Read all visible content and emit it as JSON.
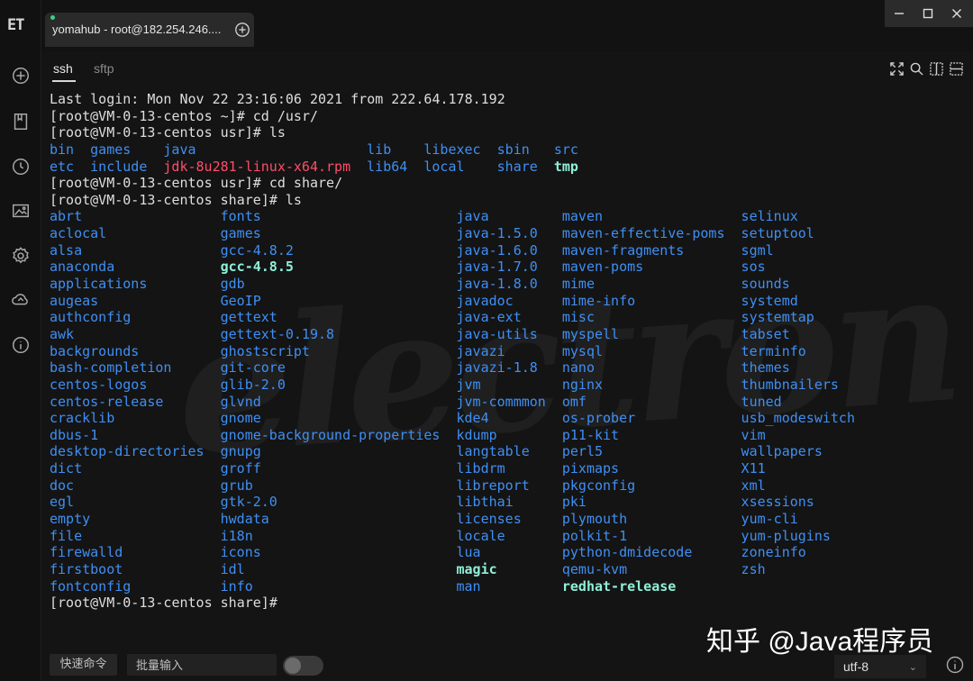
{
  "app": {
    "logo_text": "ET",
    "tab_title": "yomahub - root@182.254.246....",
    "subtabs": [
      "ssh",
      "sftp"
    ]
  },
  "colors": {
    "dir": "#3f8ff4",
    "exe": "#8ff0d8",
    "archive": "#ff4d6a",
    "plain": "#dedede",
    "session_dot": "#3ad18a"
  },
  "icons": {
    "rail": [
      "add-session-icon",
      "bookmark-icon",
      "history-icon",
      "image-icon",
      "settings-icon",
      "cloud-sync-icon",
      "info-icon"
    ],
    "toolbar": [
      "fullscreen-icon",
      "search-icon",
      "split-vertical-icon",
      "split-horizontal-icon"
    ]
  },
  "terminal": {
    "lines": [
      [
        {
          "t": "Last login: Mon Nov 22 23:16:06 2021 from 222.64.178.192",
          "c": "plain",
          "col": 0
        }
      ],
      [
        {
          "t": "[root@VM-0-13-centos ~]# cd /usr/",
          "c": "plain",
          "col": 0
        }
      ],
      [
        {
          "t": "[root@VM-0-13-centos usr]# ls",
          "c": "plain",
          "col": 0
        }
      ],
      [
        {
          "t": "bin",
          "c": "dir",
          "col": 0
        },
        {
          "t": "games",
          "c": "dir",
          "col": 5
        },
        {
          "t": "java",
          "c": "dir",
          "col": 14
        },
        {
          "t": "lib",
          "c": "dir",
          "col": 39
        },
        {
          "t": "libexec",
          "c": "dir",
          "col": 46
        },
        {
          "t": "sbin",
          "c": "dir",
          "col": 55
        },
        {
          "t": "src",
          "c": "dir",
          "col": 62
        }
      ],
      [
        {
          "t": "etc",
          "c": "dir",
          "col": 0
        },
        {
          "t": "include",
          "c": "dir",
          "col": 5
        },
        {
          "t": "jdk-8u281-linux-x64.rpm",
          "c": "archive",
          "col": 14
        },
        {
          "t": "lib64",
          "c": "dir",
          "col": 39
        },
        {
          "t": "local",
          "c": "dir",
          "col": 46
        },
        {
          "t": "share",
          "c": "dir",
          "col": 55
        },
        {
          "t": "tmp",
          "c": "exe",
          "col": 62
        }
      ],
      [
        {
          "t": "[root@VM-0-13-centos usr]# cd share/",
          "c": "plain",
          "col": 0
        }
      ],
      [
        {
          "t": "[root@VM-0-13-centos share]# ls",
          "c": "plain",
          "col": 0
        }
      ],
      [
        {
          "t": "abrt",
          "c": "dir",
          "col": 0
        },
        {
          "t": "fonts",
          "c": "dir",
          "col": 21
        },
        {
          "t": "java",
          "c": "dir",
          "col": 50
        },
        {
          "t": "maven",
          "c": "dir",
          "col": 63
        },
        {
          "t": "selinux",
          "c": "dir",
          "col": 85
        }
      ],
      [
        {
          "t": "aclocal",
          "c": "dir",
          "col": 0
        },
        {
          "t": "games",
          "c": "dir",
          "col": 21
        },
        {
          "t": "java-1.5.0",
          "c": "dir",
          "col": 50
        },
        {
          "t": "maven-effective-poms",
          "c": "dir",
          "col": 63
        },
        {
          "t": "setuptool",
          "c": "dir",
          "col": 85
        }
      ],
      [
        {
          "t": "alsa",
          "c": "dir",
          "col": 0
        },
        {
          "t": "gcc-4.8.2",
          "c": "dir",
          "col": 21
        },
        {
          "t": "java-1.6.0",
          "c": "dir",
          "col": 50
        },
        {
          "t": "maven-fragments",
          "c": "dir",
          "col": 63
        },
        {
          "t": "sgml",
          "c": "dir",
          "col": 85
        }
      ],
      [
        {
          "t": "anaconda",
          "c": "dir",
          "col": 0
        },
        {
          "t": "gcc-4.8.5",
          "c": "exe",
          "col": 21
        },
        {
          "t": "java-1.7.0",
          "c": "dir",
          "col": 50
        },
        {
          "t": "maven-poms",
          "c": "dir",
          "col": 63
        },
        {
          "t": "sos",
          "c": "dir",
          "col": 85
        }
      ],
      [
        {
          "t": "applications",
          "c": "dir",
          "col": 0
        },
        {
          "t": "gdb",
          "c": "dir",
          "col": 21
        },
        {
          "t": "java-1.8.0",
          "c": "dir",
          "col": 50
        },
        {
          "t": "mime",
          "c": "dir",
          "col": 63
        },
        {
          "t": "sounds",
          "c": "dir",
          "col": 85
        }
      ],
      [
        {
          "t": "augeas",
          "c": "dir",
          "col": 0
        },
        {
          "t": "GeoIP",
          "c": "dir",
          "col": 21
        },
        {
          "t": "javadoc",
          "c": "dir",
          "col": 50
        },
        {
          "t": "mime-info",
          "c": "dir",
          "col": 63
        },
        {
          "t": "systemd",
          "c": "dir",
          "col": 85
        }
      ],
      [
        {
          "t": "authconfig",
          "c": "dir",
          "col": 0
        },
        {
          "t": "gettext",
          "c": "dir",
          "col": 21
        },
        {
          "t": "java-ext",
          "c": "dir",
          "col": 50
        },
        {
          "t": "misc",
          "c": "dir",
          "col": 63
        },
        {
          "t": "systemtap",
          "c": "dir",
          "col": 85
        }
      ],
      [
        {
          "t": "awk",
          "c": "dir",
          "col": 0
        },
        {
          "t": "gettext-0.19.8",
          "c": "dir",
          "col": 21
        },
        {
          "t": "java-utils",
          "c": "dir",
          "col": 50
        },
        {
          "t": "myspell",
          "c": "dir",
          "col": 63
        },
        {
          "t": "tabset",
          "c": "dir",
          "col": 85
        }
      ],
      [
        {
          "t": "backgrounds",
          "c": "dir",
          "col": 0
        },
        {
          "t": "ghostscript",
          "c": "dir",
          "col": 21
        },
        {
          "t": "javazi",
          "c": "dir",
          "col": 50
        },
        {
          "t": "mysql",
          "c": "dir",
          "col": 63
        },
        {
          "t": "terminfo",
          "c": "dir",
          "col": 85
        }
      ],
      [
        {
          "t": "bash-completion",
          "c": "dir",
          "col": 0
        },
        {
          "t": "git-core",
          "c": "dir",
          "col": 21
        },
        {
          "t": "javazi-1.8",
          "c": "dir",
          "col": 50
        },
        {
          "t": "nano",
          "c": "dir",
          "col": 63
        },
        {
          "t": "themes",
          "c": "dir",
          "col": 85
        }
      ],
      [
        {
          "t": "centos-logos",
          "c": "dir",
          "col": 0
        },
        {
          "t": "glib-2.0",
          "c": "dir",
          "col": 21
        },
        {
          "t": "jvm",
          "c": "dir",
          "col": 50
        },
        {
          "t": "nginx",
          "c": "dir",
          "col": 63
        },
        {
          "t": "thumbnailers",
          "c": "dir",
          "col": 85
        }
      ],
      [
        {
          "t": "centos-release",
          "c": "dir",
          "col": 0
        },
        {
          "t": "glvnd",
          "c": "dir",
          "col": 21
        },
        {
          "t": "jvm-commmon",
          "c": "dir",
          "col": 50
        },
        {
          "t": "omf",
          "c": "dir",
          "col": 63
        },
        {
          "t": "tuned",
          "c": "dir",
          "col": 85
        }
      ],
      [
        {
          "t": "cracklib",
          "c": "dir",
          "col": 0
        },
        {
          "t": "gnome",
          "c": "dir",
          "col": 21
        },
        {
          "t": "kde4",
          "c": "dir",
          "col": 50
        },
        {
          "t": "os-prober",
          "c": "dir",
          "col": 63
        },
        {
          "t": "usb_modeswitch",
          "c": "dir",
          "col": 85
        }
      ],
      [
        {
          "t": "dbus-1",
          "c": "dir",
          "col": 0
        },
        {
          "t": "gnome-background-properties",
          "c": "dir",
          "col": 21
        },
        {
          "t": "kdump",
          "c": "dir",
          "col": 50
        },
        {
          "t": "p11-kit",
          "c": "dir",
          "col": 63
        },
        {
          "t": "vim",
          "c": "dir",
          "col": 85
        }
      ],
      [
        {
          "t": "desktop-directories",
          "c": "dir",
          "col": 0
        },
        {
          "t": "gnupg",
          "c": "dir",
          "col": 21
        },
        {
          "t": "langtable",
          "c": "dir",
          "col": 50
        },
        {
          "t": "perl5",
          "c": "dir",
          "col": 63
        },
        {
          "t": "wallpapers",
          "c": "dir",
          "col": 85
        }
      ],
      [
        {
          "t": "dict",
          "c": "dir",
          "col": 0
        },
        {
          "t": "groff",
          "c": "dir",
          "col": 21
        },
        {
          "t": "libdrm",
          "c": "dir",
          "col": 50
        },
        {
          "t": "pixmaps",
          "c": "dir",
          "col": 63
        },
        {
          "t": "X11",
          "c": "dir",
          "col": 85
        }
      ],
      [
        {
          "t": "doc",
          "c": "dir",
          "col": 0
        },
        {
          "t": "grub",
          "c": "dir",
          "col": 21
        },
        {
          "t": "libreport",
          "c": "dir",
          "col": 50
        },
        {
          "t": "pkgconfig",
          "c": "dir",
          "col": 63
        },
        {
          "t": "xml",
          "c": "dir",
          "col": 85
        }
      ],
      [
        {
          "t": "egl",
          "c": "dir",
          "col": 0
        },
        {
          "t": "gtk-2.0",
          "c": "dir",
          "col": 21
        },
        {
          "t": "libthai",
          "c": "dir",
          "col": 50
        },
        {
          "t": "pki",
          "c": "dir",
          "col": 63
        },
        {
          "t": "xsessions",
          "c": "dir",
          "col": 85
        }
      ],
      [
        {
          "t": "empty",
          "c": "dir",
          "col": 0
        },
        {
          "t": "hwdata",
          "c": "dir",
          "col": 21
        },
        {
          "t": "licenses",
          "c": "dir",
          "col": 50
        },
        {
          "t": "plymouth",
          "c": "dir",
          "col": 63
        },
        {
          "t": "yum-cli",
          "c": "dir",
          "col": 85
        }
      ],
      [
        {
          "t": "file",
          "c": "dir",
          "col": 0
        },
        {
          "t": "i18n",
          "c": "dir",
          "col": 21
        },
        {
          "t": "locale",
          "c": "dir",
          "col": 50
        },
        {
          "t": "polkit-1",
          "c": "dir",
          "col": 63
        },
        {
          "t": "yum-plugins",
          "c": "dir",
          "col": 85
        }
      ],
      [
        {
          "t": "firewalld",
          "c": "dir",
          "col": 0
        },
        {
          "t": "icons",
          "c": "dir",
          "col": 21
        },
        {
          "t": "lua",
          "c": "dir",
          "col": 50
        },
        {
          "t": "python-dmidecode",
          "c": "dir",
          "col": 63
        },
        {
          "t": "zoneinfo",
          "c": "dir",
          "col": 85
        }
      ],
      [
        {
          "t": "firstboot",
          "c": "dir",
          "col": 0
        },
        {
          "t": "idl",
          "c": "dir",
          "col": 21
        },
        {
          "t": "magic",
          "c": "exe",
          "col": 50
        },
        {
          "t": "qemu-kvm",
          "c": "dir",
          "col": 63
        },
        {
          "t": "zsh",
          "c": "dir",
          "col": 85
        }
      ],
      [
        {
          "t": "fontconfig",
          "c": "dir",
          "col": 0
        },
        {
          "t": "info",
          "c": "dir",
          "col": 21
        },
        {
          "t": "man",
          "c": "dir",
          "col": 50
        },
        {
          "t": "redhat-release",
          "c": "exe",
          "col": 63
        }
      ],
      [
        {
          "t": "[root@VM-0-13-centos share]#",
          "c": "plain",
          "col": 0
        }
      ]
    ]
  },
  "bottom": {
    "quick_command_label": "快速命令",
    "batch_input_placeholder": "批量输入",
    "encoding": "utf-8",
    "watermark": "知乎 @Java程序员"
  }
}
